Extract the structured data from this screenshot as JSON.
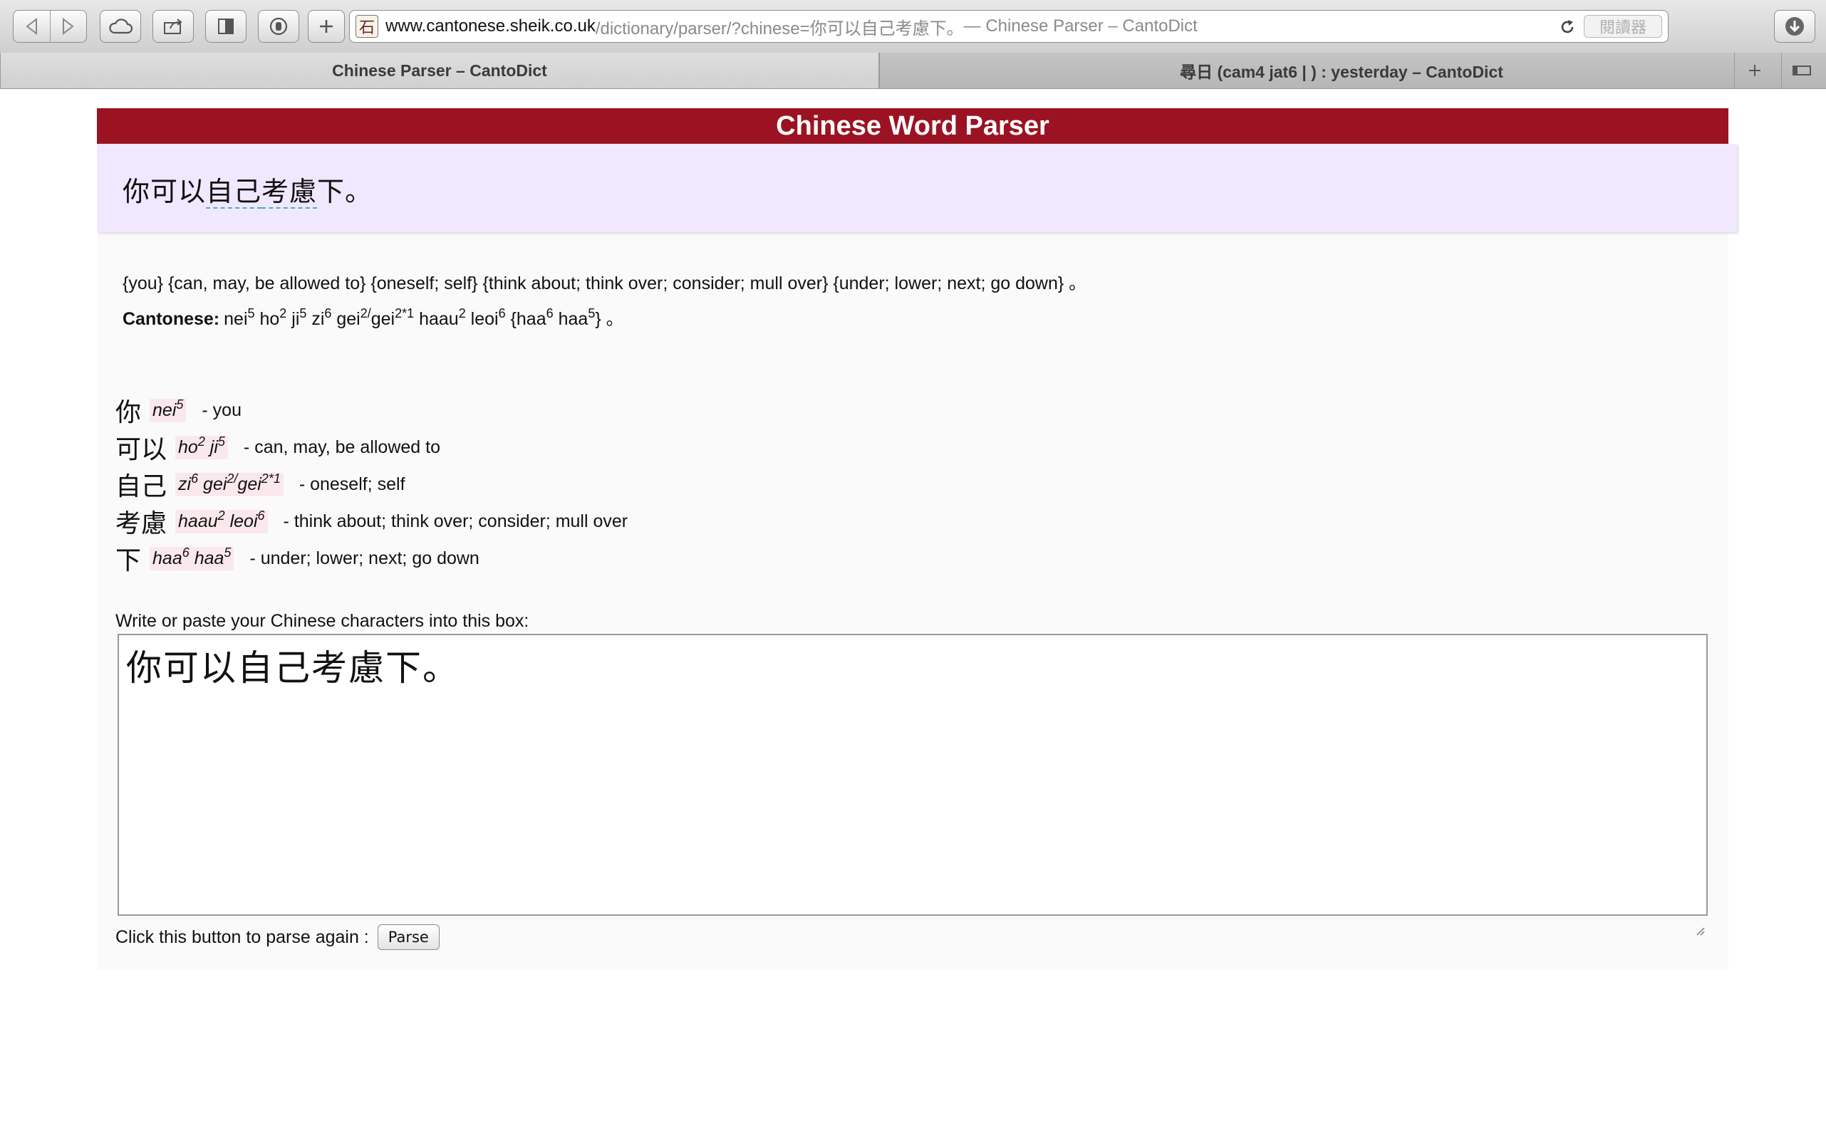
{
  "browser": {
    "url_host": "www.cantonese.sheik.co.uk",
    "url_path": "/dictionary/parser/?chinese=你可以自己考慮下。",
    "url_title": " — Chinese Parser – CantoDict",
    "reader_label": "閱讀器",
    "tabs": [
      {
        "label": "Chinese Parser – CantoDict",
        "active": true
      },
      {
        "label": "尋日 (cam4 jat6 | ) : yesterday – CantoDict",
        "active": false
      }
    ]
  },
  "page": {
    "title": "Chinese Word Parser",
    "sentence": {
      "pre": "你可以",
      "w1": "自己",
      "mid": "考慮",
      "post": "下。"
    },
    "glosses": "{you} {can, may, be allowed to} {oneself; self} {think about; think over; consider; mull over} {under; lower; next; go down} 。",
    "cantonese_label": "Cantonese:",
    "words": [
      {
        "hanzi": "你",
        "def": "- you"
      },
      {
        "hanzi": "可以",
        "def": "-  can, may, be allowed to"
      },
      {
        "hanzi": "自己",
        "def": "-  oneself; self"
      },
      {
        "hanzi": "考慮",
        "def": "-  think about; think over; consider; mull over"
      },
      {
        "hanzi": "下",
        "def": "- under; lower; next; go down"
      }
    ],
    "input_label": "Write or paste your Chinese characters into this box:",
    "input_value": "你可以自己考慮下。",
    "parse_prompt": "Click this button to parse again :",
    "parse_button": "Parse"
  }
}
